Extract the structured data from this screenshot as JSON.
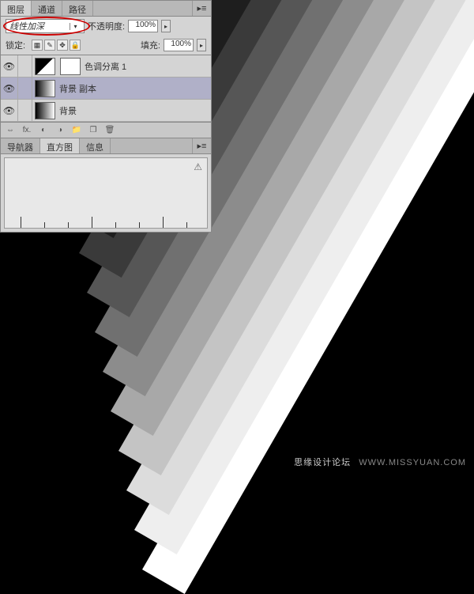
{
  "tabs": {
    "layers": "图层",
    "channels": "通道",
    "paths": "路径"
  },
  "blend_mode": "线性加深",
  "opacity": {
    "label": "不透明度:",
    "value": "100%"
  },
  "lock": {
    "label": "锁定:"
  },
  "fill": {
    "label": "填充:",
    "value": "100%"
  },
  "layers_list": [
    {
      "name": "色调分离 1",
      "visible": true,
      "thumb": "adj"
    },
    {
      "name": "背景 副本",
      "visible": true,
      "thumb": "grad",
      "active": true
    },
    {
      "name": "背景",
      "visible": true,
      "thumb": "grad"
    }
  ],
  "info_tabs": {
    "navigator": "导航器",
    "histogram": "直方图",
    "info": "信息"
  },
  "watermark": {
    "cn": "思缘设计论坛",
    "en": "WWW.MISSYUAN.COM"
  },
  "stripes": [
    {
      "l": 180,
      "t": 720,
      "c": "#ffffff"
    },
    {
      "l": 170,
      "t": 670,
      "c": "#eeeeee"
    },
    {
      "l": 160,
      "t": 620,
      "c": "#dcdcdc"
    },
    {
      "l": 150,
      "t": 570,
      "c": "#c4c4c4"
    },
    {
      "l": 140,
      "t": 520,
      "c": "#a8a8a8"
    },
    {
      "l": 130,
      "t": 470,
      "c": "#8c8c8c"
    },
    {
      "l": 120,
      "t": 420,
      "c": "#707070"
    },
    {
      "l": 110,
      "t": 370,
      "c": "#565656"
    },
    {
      "l": 100,
      "t": 320,
      "c": "#3a3a3a"
    },
    {
      "l": 90,
      "t": 270,
      "c": "#1e1e1e"
    }
  ],
  "ticks": [
    20,
    50,
    80,
    110,
    140,
    170,
    200,
    230
  ]
}
